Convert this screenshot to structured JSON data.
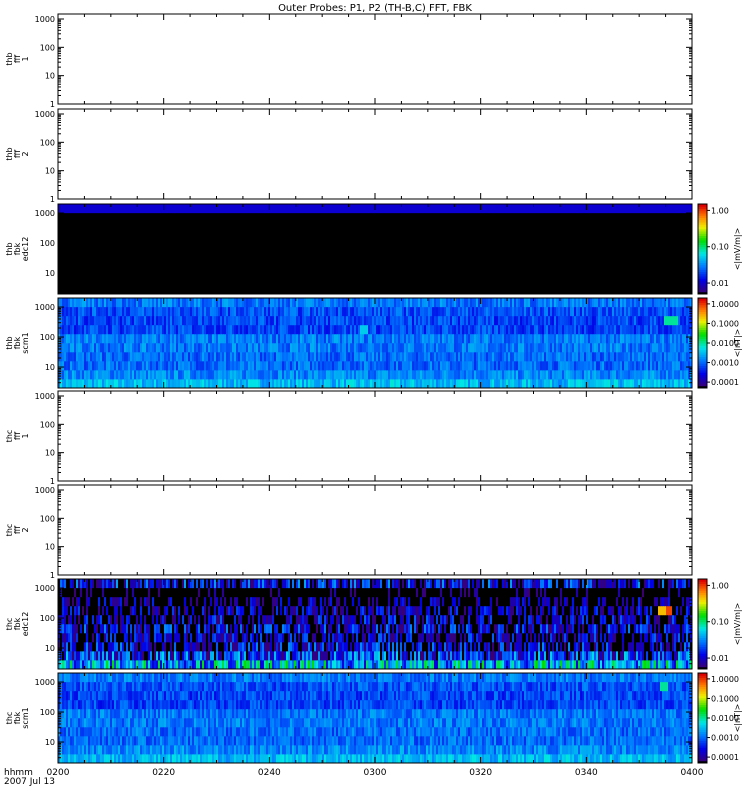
{
  "title": "Outer Probes: P1, P2 (TH-B,C) FFT, FBK",
  "time_axis": {
    "ticks": [
      "0200",
      "0220",
      "0240",
      "0300",
      "0320",
      "0340",
      "0400"
    ],
    "label_line1": "hhmm",
    "label_line2": "2007 Jul 13"
  },
  "chart_data": [
    {
      "type": "line",
      "panel": "thb-fff-1",
      "ylabel_lines": [
        "thb",
        "fff",
        "1"
      ],
      "yscale": "log",
      "yticks": [
        "1",
        "10",
        "100",
        "1000"
      ],
      "ylim": [
        1,
        1500
      ],
      "xlim": [
        "02:00",
        "04:00"
      ],
      "has_data": false
    },
    {
      "type": "line",
      "panel": "thb-fff-2",
      "ylabel_lines": [
        "thb",
        "fff",
        "2"
      ],
      "yscale": "log",
      "yticks": [
        "1",
        "10",
        "100",
        "1000"
      ],
      "ylim": [
        1,
        1500
      ],
      "xlim": [
        "02:00",
        "04:00"
      ],
      "has_data": false
    },
    {
      "type": "heatmap",
      "panel": "thb-fbk-edc12",
      "ylabel_lines": [
        "thb",
        "fbk",
        "edc12"
      ],
      "yscale": "log",
      "yticks": [
        "10",
        "100",
        "1000"
      ],
      "ylim": [
        2,
        2000
      ],
      "xlim": [
        "02:00",
        "04:00"
      ],
      "colorbar": {
        "ticks": [
          "0.01",
          "0.10",
          "1.00"
        ],
        "label": "<|mV/m|>",
        "range": [
          0.005,
          1.5
        ]
      },
      "bands_hz": [
        2,
        4,
        8,
        16,
        32,
        64,
        128,
        256,
        512,
        1024,
        2048
      ],
      "pattern": {
        "band_values": [
          0.002,
          0.002,
          0.002,
          0.002,
          0.002,
          0.002,
          0.002,
          0.002,
          0.002,
          0.01
        ],
        "noise": 0.0,
        "spikes": []
      }
    },
    {
      "type": "heatmap",
      "panel": "thb-fbk-scm1",
      "ylabel_lines": [
        "thb",
        "fbk",
        "scm1"
      ],
      "yscale": "log",
      "yticks": [
        "10",
        "100",
        "1000"
      ],
      "ylim": [
        2,
        2000
      ],
      "xlim": [
        "02:00",
        "04:00"
      ],
      "colorbar": {
        "ticks": [
          "0.0001",
          "0.0010",
          "0.0100",
          "0.1000",
          "1.0000"
        ],
        "label": "<|nT|>",
        "range": [
          5e-05,
          2
        ]
      },
      "bands_hz": [
        2,
        4,
        8,
        16,
        32,
        64,
        128,
        256,
        512,
        1024,
        2048
      ],
      "pattern": {
        "band_values": [
          0.003,
          0.0015,
          0.001,
          0.001,
          0.0012,
          0.0012,
          0.0006,
          0.0006,
          0.0007,
          0.0012
        ],
        "noise": 0.35,
        "spikes": [
          [
            0.96,
            7,
            0.01
          ],
          [
            0.97,
            7,
            0.01
          ],
          [
            0.48,
            6,
            0.004
          ]
        ]
      }
    },
    {
      "type": "line",
      "panel": "thc-fff-1",
      "ylabel_lines": [
        "thc",
        "fff",
        "1"
      ],
      "yscale": "log",
      "yticks": [
        "1",
        "10",
        "100",
        "1000"
      ],
      "ylim": [
        1,
        1500
      ],
      "xlim": [
        "02:00",
        "04:00"
      ],
      "has_data": false
    },
    {
      "type": "line",
      "panel": "thc-fff-2",
      "ylabel_lines": [
        "thc",
        "fff",
        "2"
      ],
      "yscale": "log",
      "yticks": [
        "1",
        "10",
        "100",
        "1000"
      ],
      "ylim": [
        1,
        1500
      ],
      "xlim": [
        "02:00",
        "04:00"
      ],
      "has_data": false
    },
    {
      "type": "heatmap",
      "panel": "thc-fbk-edc12",
      "ylabel_lines": [
        "thc",
        "fbk",
        "edc12"
      ],
      "yscale": "log",
      "yticks": [
        "10",
        "100",
        "1000"
      ],
      "ylim": [
        2,
        2000
      ],
      "xlim": [
        "02:00",
        "04:00"
      ],
      "colorbar": {
        "ticks": [
          "0.01",
          "0.10",
          "1.00"
        ],
        "label": "<|mV/m|>",
        "range": [
          0.005,
          1.5
        ]
      },
      "bands_hz": [
        2,
        4,
        8,
        16,
        32,
        64,
        128,
        256,
        512,
        1024,
        2048
      ],
      "pattern": {
        "band_values": [
          0.04,
          0.015,
          0.008,
          0.006,
          0.008,
          0.006,
          0.005,
          0.004,
          0.002,
          0.01
        ],
        "noise": 0.6,
        "spikes": [
          [
            0.96,
            6,
            1.0
          ],
          [
            0.95,
            6,
            0.5
          ]
        ]
      }
    },
    {
      "type": "heatmap",
      "panel": "thc-fbk-scm1",
      "ylabel_lines": [
        "thc",
        "fbk",
        "scm1"
      ],
      "yscale": "log",
      "yticks": [
        "10",
        "100",
        "1000"
      ],
      "ylim": [
        2,
        2000
      ],
      "xlim": [
        "02:00",
        "04:00"
      ],
      "colorbar": {
        "ticks": [
          "0.0001",
          "0.0010",
          "0.0100",
          "0.1000",
          "1.0000"
        ],
        "label": "<|nT|>",
        "range": [
          5e-05,
          2
        ]
      },
      "bands_hz": [
        2,
        4,
        8,
        16,
        32,
        64,
        128,
        256,
        512,
        1024,
        2048
      ],
      "pattern": {
        "band_values": [
          0.003,
          0.0015,
          0.001,
          0.001,
          0.0012,
          0.0012,
          0.0006,
          0.0006,
          0.0007,
          0.0012
        ],
        "noise": 0.35,
        "spikes": [
          [
            0.955,
            8,
            0.01
          ]
        ]
      }
    }
  ]
}
